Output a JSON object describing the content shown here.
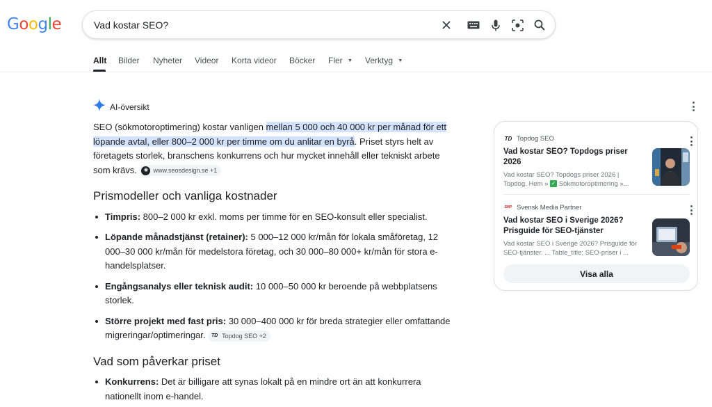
{
  "logo": {
    "letters": [
      "G",
      "o",
      "o",
      "g",
      "l",
      "e"
    ],
    "colors": [
      "#4285f4",
      "#ea4335",
      "#fbbc05",
      "#4285f4",
      "#34a853",
      "#ea4335"
    ]
  },
  "search": {
    "query": "Vad kostar SEO?"
  },
  "tabs": [
    {
      "label": "Allt",
      "active": true
    },
    {
      "label": "Bilder"
    },
    {
      "label": "Nyheter"
    },
    {
      "label": "Videor"
    },
    {
      "label": "Korta videor"
    },
    {
      "label": "Böcker"
    },
    {
      "label": "Fler",
      "dropdown": true
    },
    {
      "label": "Verktyg",
      "dropdown": true
    }
  ],
  "ai": {
    "title": "AI-översikt",
    "intro": {
      "pre": "SEO (sökmotoroptimering) kostar vanligen ",
      "highlight": "mellan 5 000 och 40 000 kr per månad för ett löpande avtal, eller 800–2 000 kr per timme om du anlitar en byrå",
      "post": ". Priset styrs helt av företagets storlek, branschens konkurrens och hur mycket innehåll eller tekniskt arbete som krävs.",
      "source_chip": "www.seosdesign.se +1"
    },
    "section1": {
      "heading": "Prismodeller och vanliga kostnader",
      "items": [
        {
          "bold": "Timpris:",
          "text": " 800–2 000 kr exkl. moms per timme för en SEO-konsult eller specialist."
        },
        {
          "bold": "Löpande månadstjänst (retainer):",
          "text": " 5 000–12 000 kr/mån för lokala småföretag, 12 000–30 000 kr/mån för medelstora företag, och 30 000–80 000+ kr/mån för stora e-handelsplatser."
        },
        {
          "bold": "Engångsanalys eller teknisk audit:",
          "text": " 10 000–50 000 kr beroende på webbplatsens storlek."
        },
        {
          "bold": "Större projekt med fast pris:",
          "text": " 30 000–400 000 kr för breda strategier eller omfattande migreringar/optimeringar.",
          "chip": "Topdog SEO +2"
        }
      ]
    },
    "section2": {
      "heading": "Vad som påverkar priset",
      "items": [
        {
          "bold": "Konkurrens:",
          "text": " Det är billigare att synas lokalt på en mindre ort än att konkurrera nationellt inom e-handel."
        }
      ]
    }
  },
  "panel": {
    "cards": [
      {
        "source": "Topdog SEO",
        "fav_text": "TD",
        "title": "Vad kostar SEO? Topdogs priser 2026",
        "snippet_a": "Vad kostar SEO? Topdogs priser 2026 | Topdog. Hem » ",
        "snippet_b": " Sökmotoroptimering »..."
      },
      {
        "source": "Svensk Media Partner",
        "fav_text": "SMP",
        "title": "Vad kostar SEO i Sverige 2026? Prisguide för SEO-tjänster",
        "snippet": "Vad kostar SEO i Sverige 2026? Prisguide för SEO-tjänster. ... Table_title: SEO-priser i ..."
      }
    ],
    "show_all": "Visa alla"
  }
}
